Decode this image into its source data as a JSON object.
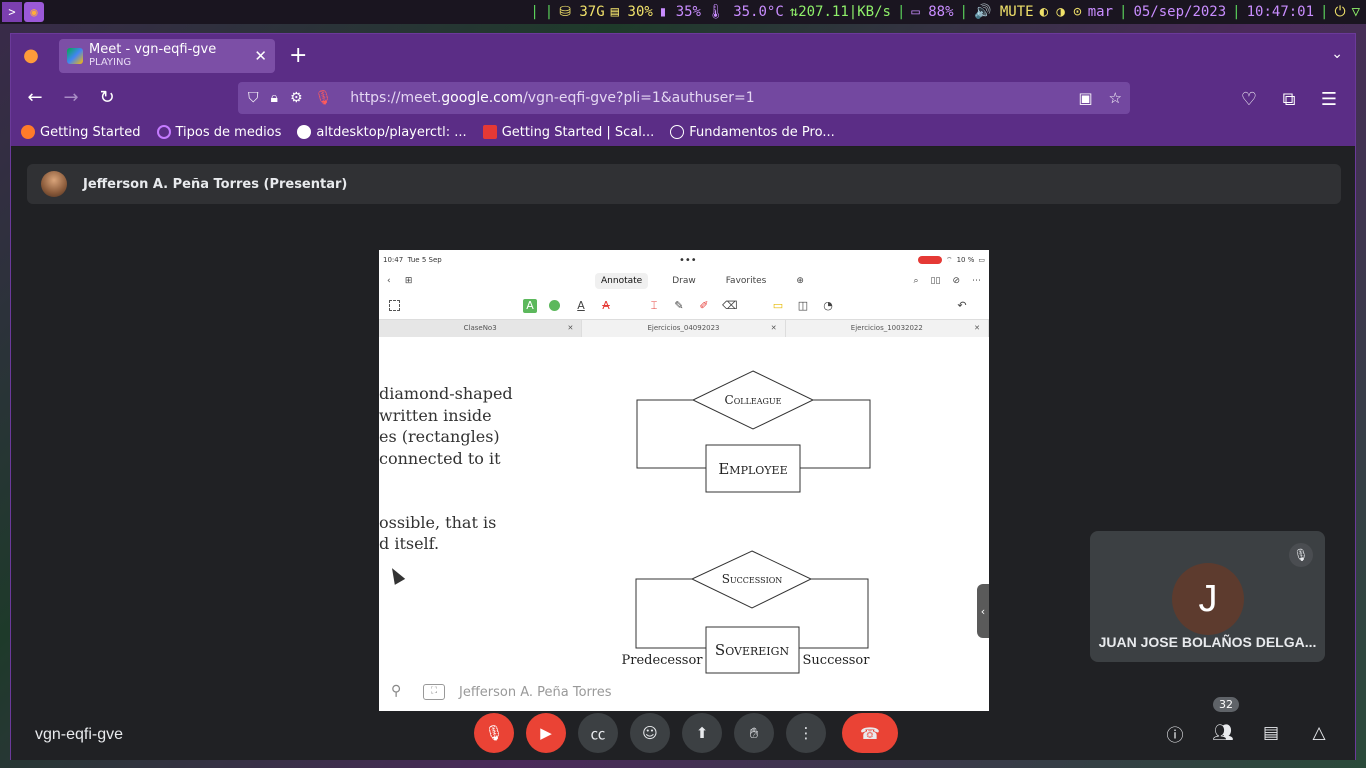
{
  "system_bar": {
    "launcher_icon": "terminal-icon",
    "disk": "37G",
    "cpu": "30%",
    "mem": "35%",
    "temp": "35.0°C",
    "net": "207.11",
    "net_unit": "KB/s",
    "battery": "88%",
    "volume": "MUTE",
    "day": "mar",
    "date": "05/sep/2023",
    "time": "10:47:01"
  },
  "browser": {
    "tab": {
      "title": "Meet - vgn-eqfi-gve",
      "subtitle": "PLAYING"
    },
    "url_prefix": "https://meet.",
    "url_domain": "google.com",
    "url_path": "/vgn-eqfi-gve?pli=1&authuser=1",
    "bookmarks": [
      {
        "label": "Getting Started",
        "color": "#ff7b2a"
      },
      {
        "label": "Tipos de medios",
        "color": "#c57bff"
      },
      {
        "label": "altdesktop/playerctl: ...",
        "color": "#ffffff"
      },
      {
        "label": "Getting Started | Scal...",
        "color": "#e53935"
      },
      {
        "label": "Fundamentos de Pro...",
        "color": "#ffffff"
      }
    ]
  },
  "meet": {
    "presenter_label": "Jefferson A. Peña Torres (Presentar)",
    "meeting_code": "vgn-eqfi-gve",
    "participant_count": "32",
    "tile": {
      "initial": "J",
      "name": "JUAN JOSE BOLAÑOS DELGA..."
    },
    "share_footer_name": "Jefferson A. Peña Torres"
  },
  "ipad": {
    "time": "10:47",
    "date": "Tue 5 Sep",
    "battery": "10 %",
    "modes": [
      "Annotate",
      "Draw",
      "Favorites"
    ],
    "doc_tabs": [
      "ClaseNo3",
      "Ejercicios_04092023",
      "Ejercicios_10032022"
    ]
  },
  "slide": {
    "text_lines": [
      "diamond-shaped",
      " written  inside",
      "es  (rectangles)",
      "connected to it",
      "ossible,  that  is",
      "d itself."
    ],
    "erd1": {
      "relationship": "Colleague",
      "entity": "Employee"
    },
    "erd2": {
      "relationship": "Succession",
      "entity": "Sovereign",
      "left_role": "Predecessor",
      "right_role": "Successor"
    }
  }
}
